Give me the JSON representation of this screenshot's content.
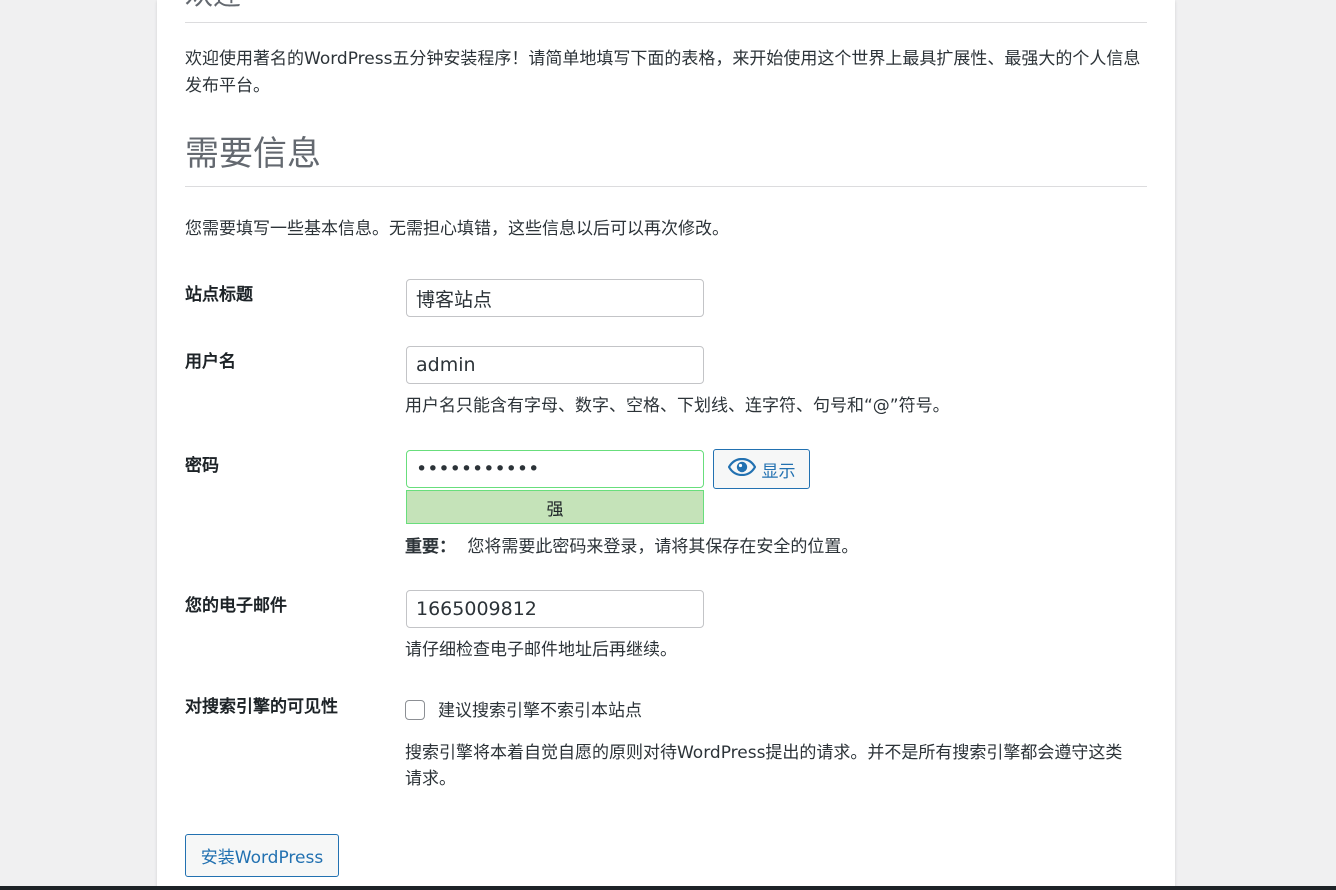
{
  "welcome": {
    "heading": "欢迎",
    "text": "欢迎使用著名的WordPress五分钟安装程序！请简单地填写下面的表格，来开始使用这个世界上最具扩展性、最强大的个人信息发布平台。"
  },
  "info": {
    "heading": "需要信息",
    "text": "您需要填写一些基本信息。无需担心填错，这些信息以后可以再次修改。"
  },
  "form": {
    "site_title": {
      "label": "站点标题",
      "value": "博客站点"
    },
    "username": {
      "label": "用户名",
      "value": "admin",
      "hint": "用户名只能含有字母、数字、空格、下划线、连字符、句号和“@”符号。"
    },
    "password": {
      "label": "密码",
      "value": "•••••••••••",
      "show_label": "显示",
      "strength": "强",
      "important_label": "重要：",
      "important_text": "您将需要此密码来登录，请将其保存在安全的位置。"
    },
    "email": {
      "label": "您的电子邮件",
      "value": "1665009812",
      "hint": "请仔细检查电子邮件地址后再继续。"
    },
    "visibility": {
      "label": "对搜索引擎的可见性",
      "checkbox_label": "建议搜索引擎不索引本站点",
      "checked": false,
      "hint": "搜索引擎将本着自觉自愿的原则对待WordPress提出的请求。并不是所有搜索引擎都会遵守这类请求。"
    }
  },
  "install_button": "安装WordPress",
  "icons": {
    "show_password": "eye-icon"
  },
  "colors": {
    "accent": "#2271b1",
    "strength_bg": "#c5e3b9",
    "strength_border": "#68de7c"
  }
}
